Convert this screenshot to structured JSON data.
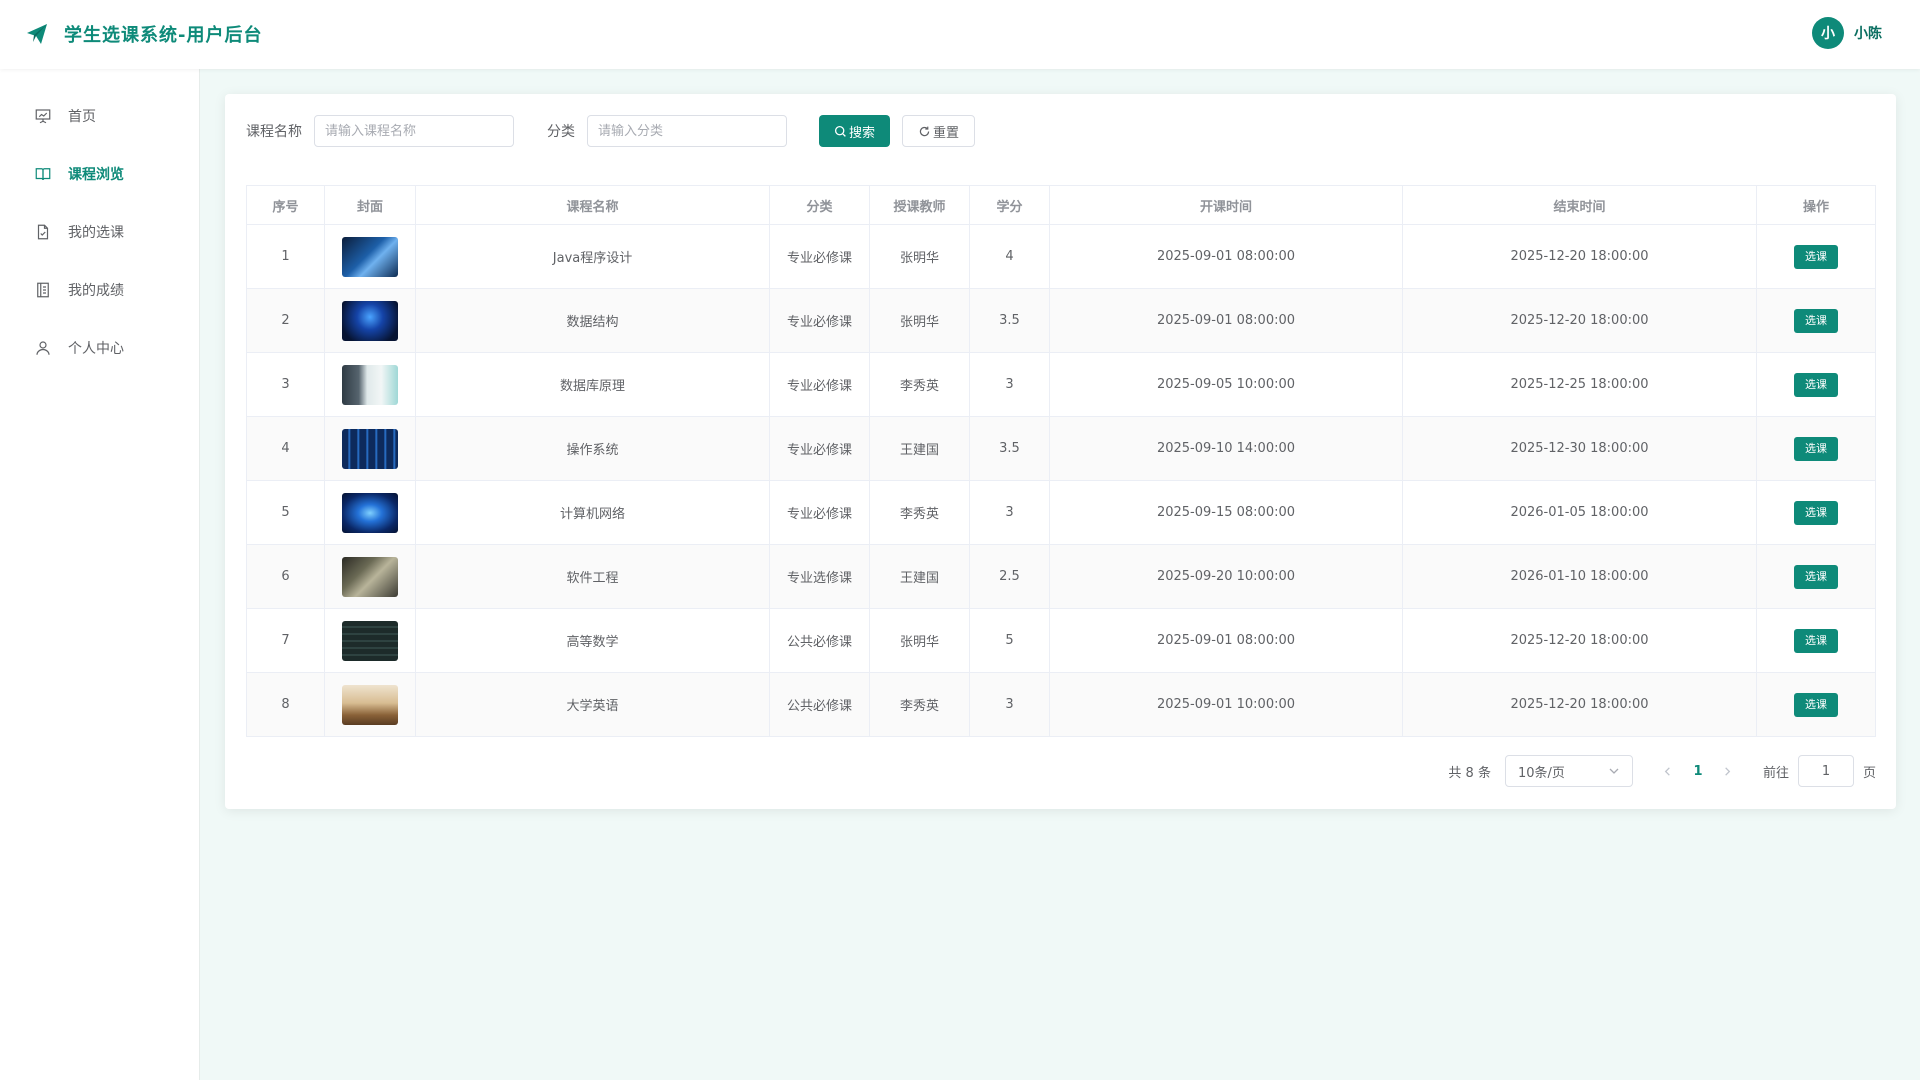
{
  "header": {
    "title": "学生选课系统-用户后台",
    "avatar_text": "小",
    "username": "小陈"
  },
  "sidebar": {
    "items": [
      {
        "label": "首页",
        "icon": "presentation-icon"
      },
      {
        "label": "课程浏览",
        "icon": "book-icon",
        "active": true
      },
      {
        "label": "我的选课",
        "icon": "document-check-icon"
      },
      {
        "label": "我的成绩",
        "icon": "notebook-icon"
      },
      {
        "label": "个人中心",
        "icon": "user-icon"
      }
    ]
  },
  "search": {
    "course_label": "课程名称",
    "course_placeholder": "请输入课程名称",
    "category_label": "分类",
    "category_placeholder": "请输入分类",
    "search_button": "搜索",
    "reset_button": "重置"
  },
  "table": {
    "headers": [
      "序号",
      "封面",
      "课程名称",
      "分类",
      "授课教师",
      "学分",
      "开课时间",
      "结束时间",
      "操作"
    ],
    "action_label": "选课",
    "rows": [
      {
        "no": "1",
        "name": "Java程序设计",
        "category": "专业必修课",
        "teacher": "张明华",
        "credit": "4",
        "start": "2025-09-01 08:00:00",
        "end": "2025-12-20 18:00:00"
      },
      {
        "no": "2",
        "name": "数据结构",
        "category": "专业必修课",
        "teacher": "张明华",
        "credit": "3.5",
        "start": "2025-09-01 08:00:00",
        "end": "2025-12-20 18:00:00"
      },
      {
        "no": "3",
        "name": "数据库原理",
        "category": "专业必修课",
        "teacher": "李秀英",
        "credit": "3",
        "start": "2025-09-05 10:00:00",
        "end": "2025-12-25 18:00:00"
      },
      {
        "no": "4",
        "name": "操作系统",
        "category": "专业必修课",
        "teacher": "王建国",
        "credit": "3.5",
        "start": "2025-09-10 14:00:00",
        "end": "2025-12-30 18:00:00"
      },
      {
        "no": "5",
        "name": "计算机网络",
        "category": "专业必修课",
        "teacher": "李秀英",
        "credit": "3",
        "start": "2025-09-15 08:00:00",
        "end": "2026-01-05 18:00:00"
      },
      {
        "no": "6",
        "name": "软件工程",
        "category": "专业选修课",
        "teacher": "王建国",
        "credit": "2.5",
        "start": "2025-09-20 10:00:00",
        "end": "2026-01-10 18:00:00"
      },
      {
        "no": "7",
        "name": "高等数学",
        "category": "公共必修课",
        "teacher": "张明华",
        "credit": "5",
        "start": "2025-09-01 08:00:00",
        "end": "2025-12-20 18:00:00"
      },
      {
        "no": "8",
        "name": "大学英语",
        "category": "公共必修课",
        "teacher": "李秀英",
        "credit": "3",
        "start": "2025-09-01 10:00:00",
        "end": "2025-12-20 18:00:00"
      }
    ]
  },
  "pagination": {
    "total_text": "共 8 条",
    "page_size": "10条/页",
    "current_page": "1",
    "goto_label": "前往",
    "goto_value": "1",
    "page_suffix": "页"
  },
  "colors": {
    "accent": "#0e8a79",
    "background": "#f0f9f7"
  }
}
